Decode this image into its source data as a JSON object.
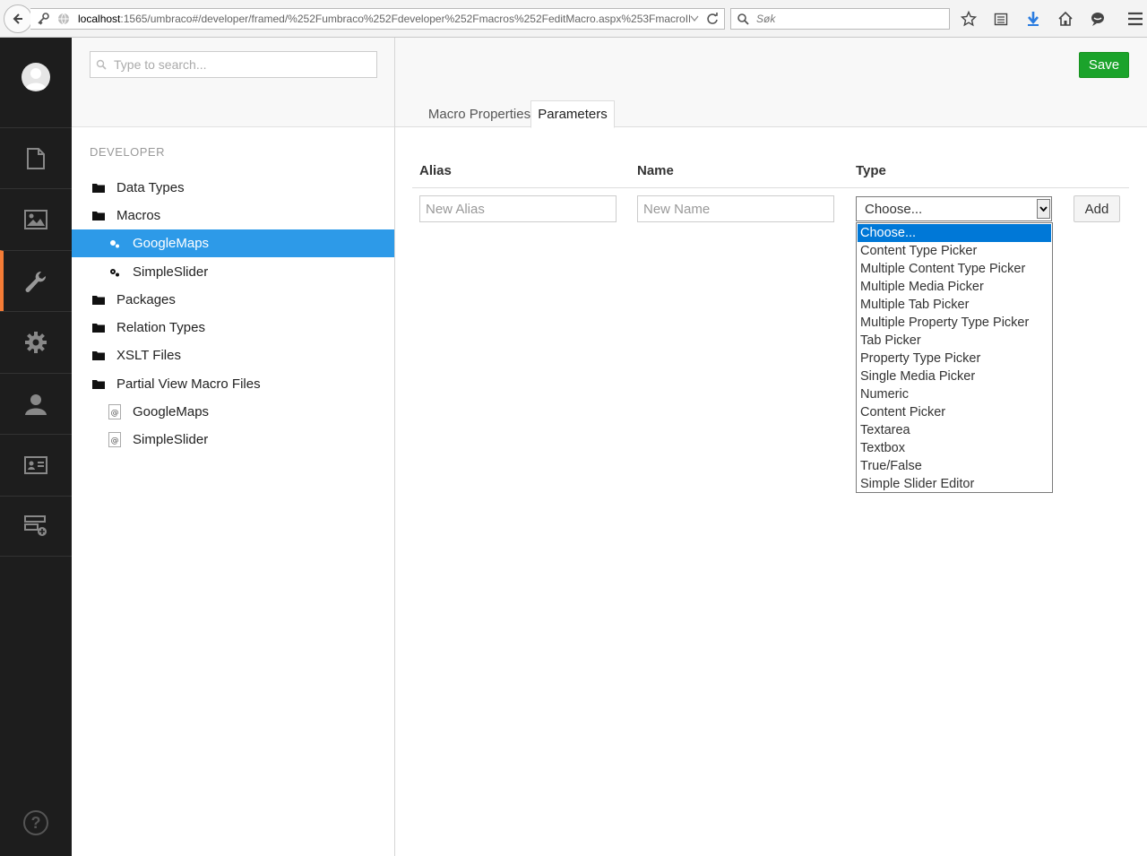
{
  "browser": {
    "url_host": "localhost",
    "url_rest": ":1565/umbraco#/developer/framed/%252Fumbraco%252Fdeveloper%252Fmacros%252FeditMacro.aspx%253FmacroID%",
    "search_placeholder": "Søk"
  },
  "tree": {
    "search_placeholder": "Type to search...",
    "section_title": "DEVELOPER",
    "items": [
      {
        "label": "Data Types",
        "icon": "folder-icon"
      },
      {
        "label": "Macros",
        "icon": "folder-icon"
      },
      {
        "label": "GoogleMaps",
        "icon": "gears-icon",
        "selected": true
      },
      {
        "label": "SimpleSlider",
        "icon": "gears-icon"
      },
      {
        "label": "Packages",
        "icon": "folder-icon"
      },
      {
        "label": "Relation Types",
        "icon": "folder-icon"
      },
      {
        "label": "XSLT Files",
        "icon": "folder-icon"
      },
      {
        "label": "Partial View Macro Files",
        "icon": "folder-icon"
      },
      {
        "label": "GoogleMaps",
        "icon": "razor-file-icon"
      },
      {
        "label": "SimpleSlider",
        "icon": "razor-file-icon"
      }
    ]
  },
  "editor": {
    "save_label": "Save",
    "tabs": [
      "Macro Properties",
      "Parameters"
    ],
    "active_tab": "Parameters",
    "columns": {
      "alias": "Alias",
      "name": "Name",
      "type": "Type"
    },
    "alias_placeholder": "New Alias",
    "name_placeholder": "New Name",
    "type_selected": "Choose...",
    "add_label": "Add",
    "type_options": [
      "Choose...",
      "Content Type Picker",
      "Multiple Content Type Picker",
      "Multiple Media Picker",
      "Multiple Tab Picker",
      "Multiple Property Type Picker",
      "Tab Picker",
      "Property Type Picker",
      "Single Media Picker",
      "Numeric",
      "Content Picker",
      "Textarea",
      "Textbox",
      "True/False",
      "Simple Slider Editor"
    ]
  },
  "colors": {
    "nav_bg": "#1d1d1d",
    "nav_accent": "#f57c36",
    "tree_selected": "#2d9ae8",
    "save_green": "#1ba32b",
    "dropdown_highlight": "#0078d7"
  }
}
